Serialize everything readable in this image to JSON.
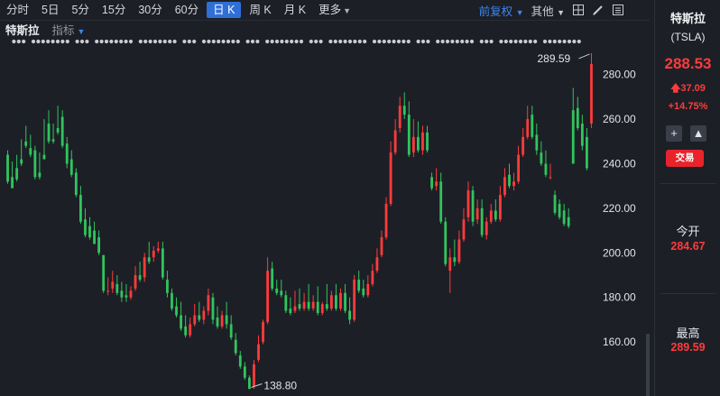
{
  "toolbar": {
    "periods": [
      "分时",
      "5日",
      "5分",
      "15分",
      "30分",
      "60分",
      "日 K",
      "周 K",
      "月 K",
      "更多"
    ],
    "active_period": "日 K",
    "adjust_label": "前复权",
    "other_label": "其他",
    "icons": [
      "grid-icon",
      "pen-icon",
      "list-icon"
    ]
  },
  "subbar": {
    "stock_name": "特斯拉",
    "indicator_label": "指标"
  },
  "chart_controls": [
    "minus-icon",
    "plus-icon",
    "gear-icon",
    "close-icon"
  ],
  "chart_data": {
    "type": "candlestick",
    "y_ticks": [
      "280.00",
      "260.00",
      "240.00",
      "220.00",
      "200.00",
      "180.00",
      "160.00"
    ],
    "y_tick_values": [
      280,
      260,
      240,
      220,
      200,
      180,
      160
    ],
    "ylim": [
      137.8,
      291.6
    ],
    "high_annotation": {
      "label": "289.59",
      "value": 289.59
    },
    "low_annotation": {
      "label": "138.80",
      "value": 138.8
    },
    "colors": {
      "up": "#ff3b3b",
      "down": "#30c55e"
    },
    "candles": [
      [
        244,
        246,
        232,
        231
      ],
      [
        234,
        241,
        229,
        229
      ],
      [
        238,
        244,
        233,
        232
      ],
      [
        242,
        251,
        240,
        239
      ],
      [
        250,
        257,
        248,
        247
      ],
      [
        247,
        253,
        244,
        243
      ],
      [
        246,
        248,
        234,
        233
      ],
      [
        236,
        245,
        234,
        233
      ],
      [
        244,
        260,
        242,
        242
      ],
      [
        258,
        264,
        250,
        249
      ],
      [
        251,
        258,
        250,
        249
      ],
      [
        256,
        266,
        254,
        253
      ],
      [
        261,
        264,
        248,
        247
      ],
      [
        249,
        252,
        240,
        238
      ],
      [
        242,
        246,
        235,
        234
      ],
      [
        236,
        238,
        226,
        225
      ],
      [
        226,
        230,
        214,
        213
      ],
      [
        215,
        220,
        208,
        207
      ],
      [
        212,
        216,
        207,
        206
      ],
      [
        210,
        214,
        204,
        204
      ],
      [
        207,
        210,
        200,
        199
      ],
      [
        199,
        199,
        183,
        182
      ],
      [
        183,
        189,
        183,
        181
      ],
      [
        184,
        192,
        187,
        182
      ],
      [
        186,
        190,
        182,
        181
      ],
      [
        183,
        187,
        180,
        178
      ],
      [
        181,
        186,
        180,
        178
      ],
      [
        180,
        185,
        183,
        179
      ],
      [
        184,
        194,
        190,
        183
      ],
      [
        190,
        196,
        188,
        187
      ],
      [
        189,
        200,
        198,
        187
      ],
      [
        198,
        205,
        196,
        195
      ],
      [
        198,
        203,
        201,
        196
      ],
      [
        201,
        205,
        202,
        200
      ],
      [
        202,
        205,
        189,
        188
      ],
      [
        188,
        192,
        182,
        180
      ],
      [
        182,
        184,
        175,
        174
      ],
      [
        176,
        180,
        172,
        171
      ],
      [
        172,
        178,
        166,
        165
      ],
      [
        167,
        172,
        163,
        162
      ],
      [
        163,
        171,
        168,
        162
      ],
      [
        168,
        177,
        172,
        167
      ],
      [
        172,
        178,
        170,
        169
      ],
      [
        170,
        176,
        174,
        168
      ],
      [
        174,
        184,
        181,
        172
      ],
      [
        180,
        182,
        170,
        168
      ],
      [
        171,
        176,
        167,
        166
      ],
      [
        167,
        174,
        172,
        166
      ],
      [
        172,
        178,
        168,
        166
      ],
      [
        168,
        172,
        162,
        161
      ],
      [
        161,
        164,
        155,
        154
      ],
      [
        154,
        156,
        149,
        148
      ],
      [
        149,
        151,
        144,
        143
      ],
      [
        144,
        145,
        139,
        138.8
      ],
      [
        140,
        152,
        150,
        139
      ],
      [
        152,
        163,
        159,
        151
      ],
      [
        160,
        170,
        169,
        159
      ],
      [
        169,
        198,
        192,
        168
      ],
      [
        193,
        196,
        184,
        183
      ],
      [
        184,
        188,
        182,
        181
      ],
      [
        183,
        188,
        181,
        180
      ],
      [
        181,
        183,
        174,
        173
      ],
      [
        175,
        180,
        173,
        172
      ],
      [
        174,
        183,
        176,
        173
      ],
      [
        177,
        184,
        175,
        174
      ],
      [
        175,
        182,
        178,
        174
      ],
      [
        178,
        186,
        175,
        174
      ],
      [
        175,
        181,
        178,
        174
      ],
      [
        178,
        185,
        173,
        172
      ],
      [
        173,
        178,
        177,
        172
      ],
      [
        177,
        186,
        175,
        174
      ],
      [
        175,
        183,
        181,
        174
      ],
      [
        181,
        186,
        175,
        174
      ],
      [
        175,
        184,
        182,
        174
      ],
      [
        182,
        186,
        174,
        173
      ],
      [
        174,
        180,
        170,
        168
      ],
      [
        170,
        190,
        188,
        169
      ],
      [
        188,
        192,
        183,
        182
      ],
      [
        184,
        188,
        181,
        180
      ],
      [
        181,
        190,
        186,
        180
      ],
      [
        186,
        195,
        192,
        185
      ],
      [
        192,
        202,
        198,
        191
      ],
      [
        199,
        210,
        207,
        198
      ],
      [
        207,
        225,
        222,
        206
      ],
      [
        222,
        250,
        245,
        221
      ],
      [
        245,
        260,
        255,
        244
      ],
      [
        256,
        270,
        266,
        254
      ],
      [
        266,
        272,
        262,
        260
      ],
      [
        262,
        268,
        244,
        243
      ],
      [
        245,
        260,
        252,
        243
      ],
      [
        252,
        259,
        246,
        245
      ],
      [
        246,
        257,
        254,
        244
      ],
      [
        254,
        257,
        246,
        245
      ],
      [
        234,
        236,
        229,
        228
      ],
      [
        230,
        238,
        232,
        228
      ],
      [
        232,
        236,
        214,
        213
      ],
      [
        214,
        216,
        195,
        194
      ],
      [
        192,
        202,
        198,
        182
      ],
      [
        198,
        206,
        196,
        194
      ],
      [
        196,
        210,
        206,
        195
      ],
      [
        206,
        220,
        215,
        205
      ],
      [
        216,
        232,
        228,
        214
      ],
      [
        228,
        230,
        214,
        212
      ],
      [
        215,
        224,
        220,
        213
      ],
      [
        220,
        224,
        208,
        207
      ],
      [
        208,
        216,
        214,
        206
      ],
      [
        214,
        222,
        219,
        213
      ],
      [
        219,
        224,
        215,
        214
      ],
      [
        215,
        230,
        226,
        214
      ],
      [
        226,
        238,
        234,
        225
      ],
      [
        235,
        240,
        230,
        229
      ],
      [
        230,
        236,
        232,
        228
      ],
      [
        232,
        248,
        244,
        231
      ],
      [
        244,
        256,
        252,
        243
      ],
      [
        252,
        266,
        260,
        251
      ],
      [
        262,
        266,
        252,
        251
      ],
      [
        253,
        258,
        246,
        244
      ],
      [
        245,
        250,
        240,
        239
      ],
      [
        240,
        246,
        235,
        234
      ],
      [
        234,
        240,
        234,
        233
      ],
      [
        226,
        228,
        218,
        217
      ],
      [
        222,
        224,
        216,
        215
      ],
      [
        219,
        222,
        213,
        212
      ],
      [
        216,
        220,
        212,
        211
      ],
      [
        264,
        274,
        240,
        240
      ],
      [
        265,
        270,
        256,
        255
      ],
      [
        258,
        262,
        248,
        246
      ],
      [
        252,
        256,
        238,
        237
      ],
      [
        258,
        289.59,
        284.67,
        256
      ]
    ]
  },
  "sidebar": {
    "name": "特斯拉",
    "code": "(TSLA)",
    "price": "288.53",
    "change": "37.09",
    "change_pct": "+14.75%",
    "trade_label": "交易",
    "open_label": "今开",
    "open_value": "284.67",
    "high_label": "最高",
    "high_value": "289.59",
    "up_color": "#ff3b3b"
  }
}
